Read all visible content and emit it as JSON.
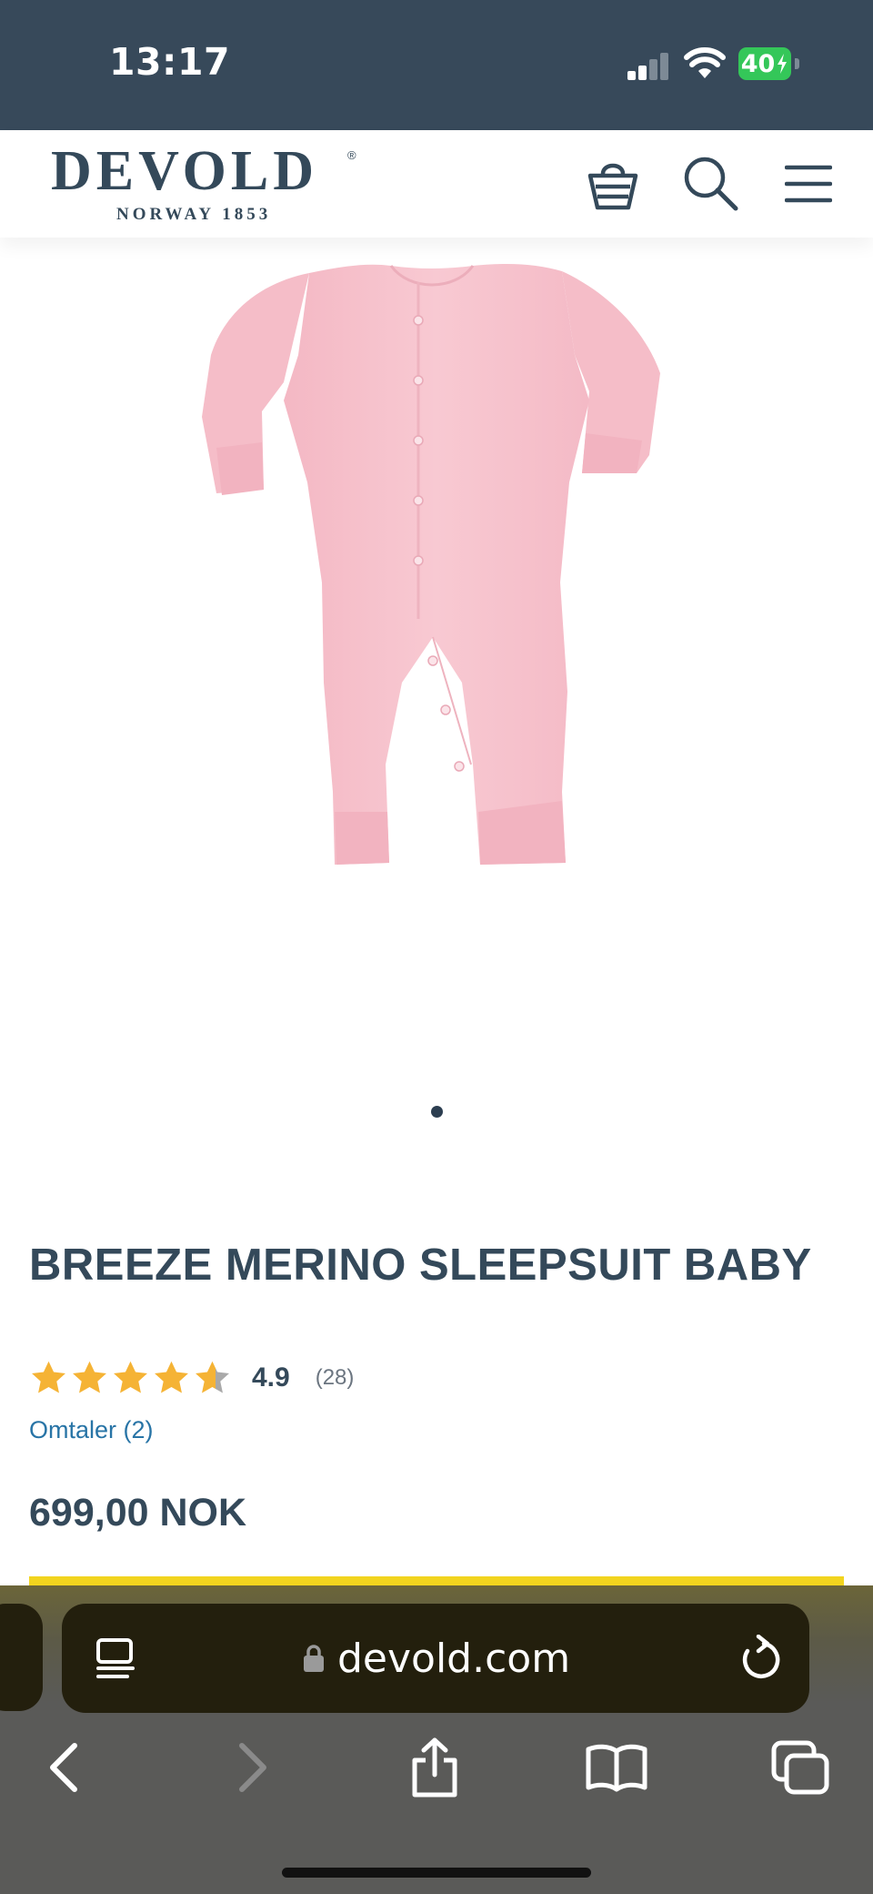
{
  "status_bar": {
    "time": "13:17",
    "battery_level": "40",
    "icons": [
      "signal-icon",
      "wifi-icon",
      "battery-charging-icon"
    ]
  },
  "header": {
    "brand_name": "DEVOLD",
    "brand_tagline": "NORWAY 1853",
    "icons": [
      "shopping-basket-icon",
      "search-icon",
      "hamburger-menu-icon"
    ]
  },
  "product": {
    "image_alt": "pink-merino-sleepsuit",
    "title": "BREEZE MERINO SLEEPSUIT BABY",
    "rating": 4.9,
    "rating_text": "4.9",
    "rating_count": "(28)",
    "reviews_link": "Omtaler (2)",
    "price": "699,00 NOK",
    "carousel": {
      "current": 1,
      "total": 1
    }
  },
  "browser": {
    "url": "devold.com",
    "icons": [
      "reader-mode-icon",
      "lock-icon",
      "reload-icon",
      "back-icon",
      "forward-icon",
      "share-icon",
      "bookmarks-icon",
      "tabs-icon"
    ]
  },
  "colors": {
    "brand_dark": "#34495a",
    "star": "#f5b335",
    "link": "#2874a6",
    "cta_yellow": "#f2d41e",
    "product_pink": "#f6c2cc"
  }
}
